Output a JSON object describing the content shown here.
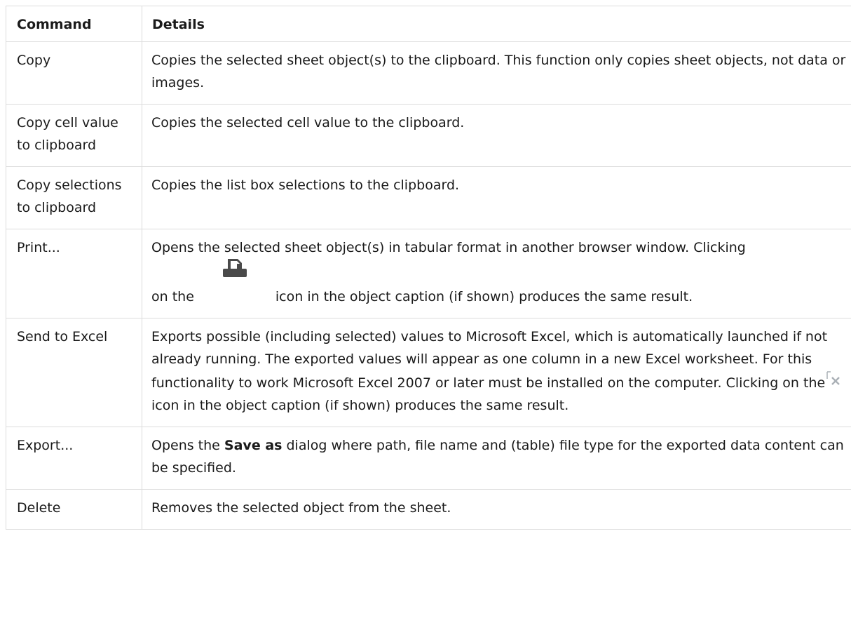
{
  "table": {
    "headers": {
      "command": "Command",
      "details": "Details"
    },
    "rows": [
      {
        "command": "Copy",
        "details": "Copies the selected sheet object(s) to the clipboard. This function only copies sheet objects, not data or images."
      },
      {
        "command": "Copy cell value to clipboard",
        "details": "Copies the selected cell value to the clipboard."
      },
      {
        "command": "Copy selections to clipboard",
        "details": "Copies the list box selections to the clipboard."
      },
      {
        "command": "Print...",
        "details_line1": "Opens the selected sheet object(s) in tabular format in another browser window. Clicking",
        "details_before_icon": "on the",
        "details_after_icon": "icon in the object caption (if shown) produces the same result.",
        "icon": "printer-icon"
      },
      {
        "command": "Send to Excel",
        "details_before_icon": "Exports possible (including selected) values to Microsoft Excel, which is automatically launched if not already running. The exported values will appear as one column in a new Excel worksheet. For this functionality to work Microsoft Excel 2007 or later must be installed on the computer. Clicking on the",
        "details_after_icon": "icon in the object caption (if shown) produces the same result.",
        "icon": "excel-export-icon"
      },
      {
        "command": "Export...",
        "details_before_bold": "Opens the",
        "details_bold": "Save as",
        "details_after_bold": "dialog where path, file name and (table) file type for the exported data content can be specified."
      },
      {
        "command": "Delete",
        "details": "Removes the selected object from the sheet."
      }
    ]
  },
  "colors": {
    "border": "#dcdcdc",
    "text": "#1a1a1a",
    "icon_dark": "#4a4a4a"
  }
}
